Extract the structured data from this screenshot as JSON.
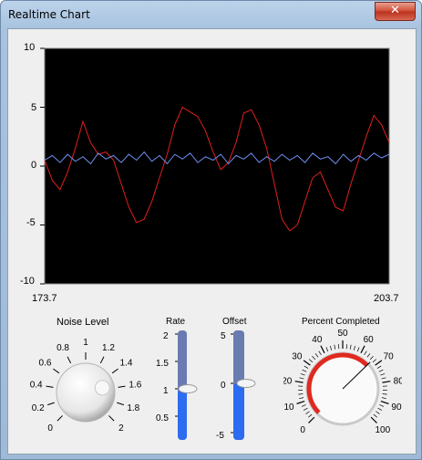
{
  "window": {
    "title": "Realtime Chart",
    "close_symbol": "✕"
  },
  "chart": {
    "y_ticks": [
      "10",
      "5",
      "0",
      "-5",
      "-10"
    ],
    "x_start": "173.7",
    "x_end": "203.7",
    "background": "#000000",
    "series_colors": {
      "red": "#e0201b",
      "blue": "#6f8ff0"
    }
  },
  "chart_data": {
    "type": "line",
    "xlim": [
      173.7,
      203.7
    ],
    "ylim": [
      -10,
      10
    ],
    "series": [
      {
        "color": "#e0201b",
        "values": [
          0.5,
          -1.2,
          -2.0,
          -0.5,
          1.5,
          3.8,
          2.0,
          1.0,
          1.2,
          0.5,
          -1.5,
          -3.5,
          -4.8,
          -4.5,
          -3.0,
          -1.0,
          1.0,
          3.5,
          5.0,
          4.6,
          4.2,
          3.0,
          1.2,
          -0.3,
          0.3,
          2.0,
          4.5,
          4.8,
          3.5,
          1.5,
          -1.5,
          -4.5,
          -5.5,
          -5.0,
          -3.0,
          -1.0,
          -0.5,
          -2.0,
          -3.5,
          -3.8,
          -1.5,
          0.5,
          2.5,
          4.3,
          3.5,
          2.0
        ]
      },
      {
        "color": "#6f8ff0",
        "values": [
          0.5,
          0.9,
          0.3,
          1.0,
          0.4,
          0.8,
          0.2,
          1.1,
          0.6,
          0.9,
          0.3,
          1.0,
          0.5,
          1.2,
          0.4,
          0.9,
          0.2,
          1.0,
          0.6,
          1.1,
          0.3,
          0.8,
          0.5,
          1.0,
          0.2,
          0.9,
          0.6,
          1.1,
          0.3,
          0.8,
          0.4,
          1.0,
          0.5,
          0.9,
          0.3,
          1.1,
          0.6,
          0.8,
          0.2,
          1.0,
          0.4,
          0.9,
          0.5,
          1.1,
          0.7,
          1.0
        ]
      }
    ]
  },
  "noise": {
    "label": "Noise Level",
    "ticks": [
      "0",
      "0.2",
      "0.4",
      "0.6",
      "0.8",
      "1",
      "1.2",
      "1.4",
      "1.6",
      "1.8",
      "2"
    ],
    "value": 1.55
  },
  "rate": {
    "label": "Rate",
    "ticks": [
      "2",
      "1.5",
      "1",
      "0.5"
    ],
    "value": 1.0,
    "min": 0,
    "max": 2
  },
  "offset": {
    "label": "Offset",
    "ticks": [
      "5",
      "0",
      "-5"
    ],
    "value": 0.0,
    "min": -6,
    "max": 6
  },
  "percent": {
    "label": "Percent Completed",
    "ticks": [
      "0",
      "10",
      "20",
      "30",
      "40",
      "50",
      "60",
      "70",
      "80",
      "90",
      "100"
    ],
    "value": 67,
    "arc_color": "#e02a20"
  }
}
